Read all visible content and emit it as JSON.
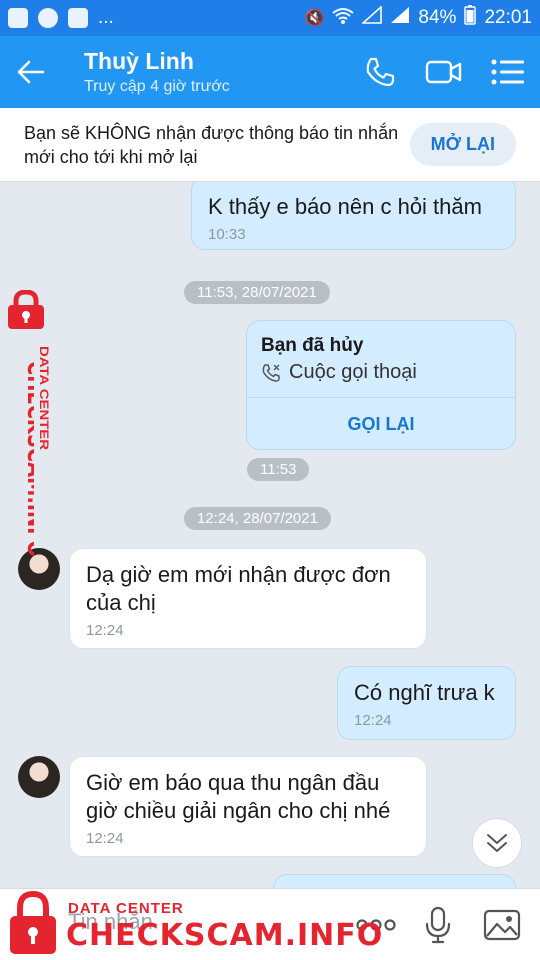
{
  "status_bar": {
    "notif_more": "...",
    "battery": "84%",
    "time": "22:01"
  },
  "header": {
    "name": "Thuỳ Linh",
    "last_seen": "Truy cập 4 giờ trước"
  },
  "notice": {
    "text": "Bạn sẽ KHÔNG nhận được thông báo tin nhắn mới cho tới khi mở lại",
    "button": "MỞ LẠI"
  },
  "messages": [
    {
      "side": "mine",
      "text": "K thấy e báo nên c hỏi thăm",
      "time": "10:33"
    },
    {
      "type": "separator",
      "text": "11:53, 28/07/2021"
    },
    {
      "type": "call",
      "title": "Bạn đã hủy",
      "subtitle": "Cuộc gọi thoại",
      "action": "GỌI LẠI",
      "time": "11:53"
    },
    {
      "type": "separator",
      "text": "12:24, 28/07/2021"
    },
    {
      "side": "theirs",
      "text": "Dạ giờ em mới nhận được đơn của chị",
      "time": "12:24"
    },
    {
      "side": "mine",
      "text": "Có nghĩ trưa k",
      "time": "12:24"
    },
    {
      "side": "theirs",
      "text": "Giờ em báo qua thu ngân đầu giờ chiều giải ngân cho chị nhé",
      "time": "12:24"
    }
  ],
  "input": {
    "placeholder": "Tin nhắn"
  },
  "watermark": {
    "small": "DATA CENTER",
    "big": "CHECKSCAM.INFO"
  },
  "colors": {
    "header": "#2196f3",
    "statusbar": "#1f7ee8",
    "accent": "#1976d2",
    "watermark": "#e4252f"
  }
}
